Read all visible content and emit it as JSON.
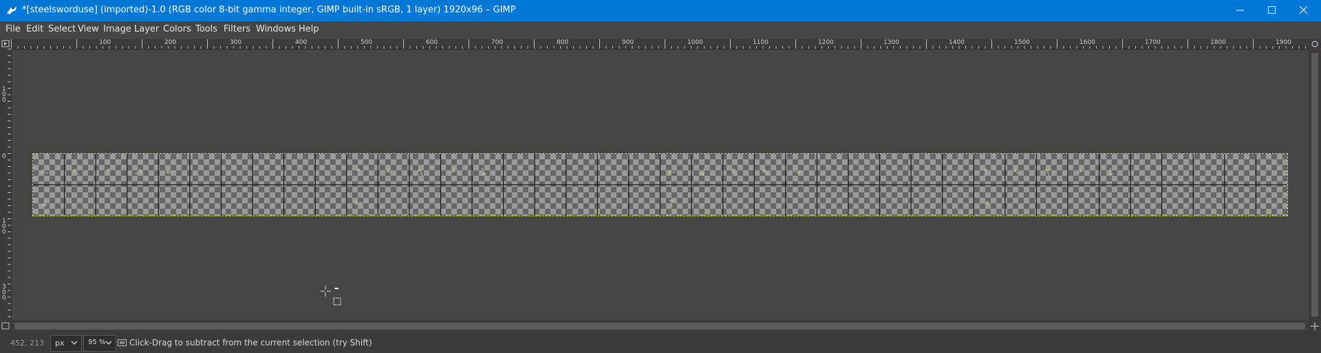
{
  "window": {
    "title": "*[steelsworduse] (imported)-1.0 (RGB color 8-bit gamma integer, GIMP built-in sRGB, 1 layer) 1920x96 – GIMP",
    "controls": [
      "minimize-icon",
      "maximize-icon",
      "close-icon"
    ]
  },
  "menu": {
    "items": [
      "File",
      "Edit",
      "Select",
      "View",
      "Image",
      "Layer",
      "Colors",
      "Tools",
      "Filters",
      "Windows",
      "Help"
    ]
  },
  "rulers": {
    "horizontal_labels": [
      "100",
      "200",
      "300",
      "400",
      "500",
      "600",
      "700",
      "800",
      "900",
      "1000",
      "1100",
      "1200",
      "1300",
      "1400",
      "1500",
      "1600",
      "1700",
      "1800",
      "1900"
    ],
    "vertical_labels": [
      "100",
      "0",
      "100",
      "300"
    ]
  },
  "canvas": {
    "image_size": "1920x96",
    "tile_columns": 40,
    "tile_rows": 2,
    "background": "#454545",
    "checker_light": "#9a9a9a",
    "checker_dark": "#666666",
    "layer_boundary_color": "#e8e000"
  },
  "statusbar": {
    "coordinates": "452, 213",
    "unit": "px",
    "zoom": "95 %",
    "message": "Click-Drag to subtract from the current selection (try Shift)"
  },
  "colors": {
    "titlebar": "#0078d7",
    "ui_dark": "#454545",
    "ruler": "#3b3b3b"
  }
}
